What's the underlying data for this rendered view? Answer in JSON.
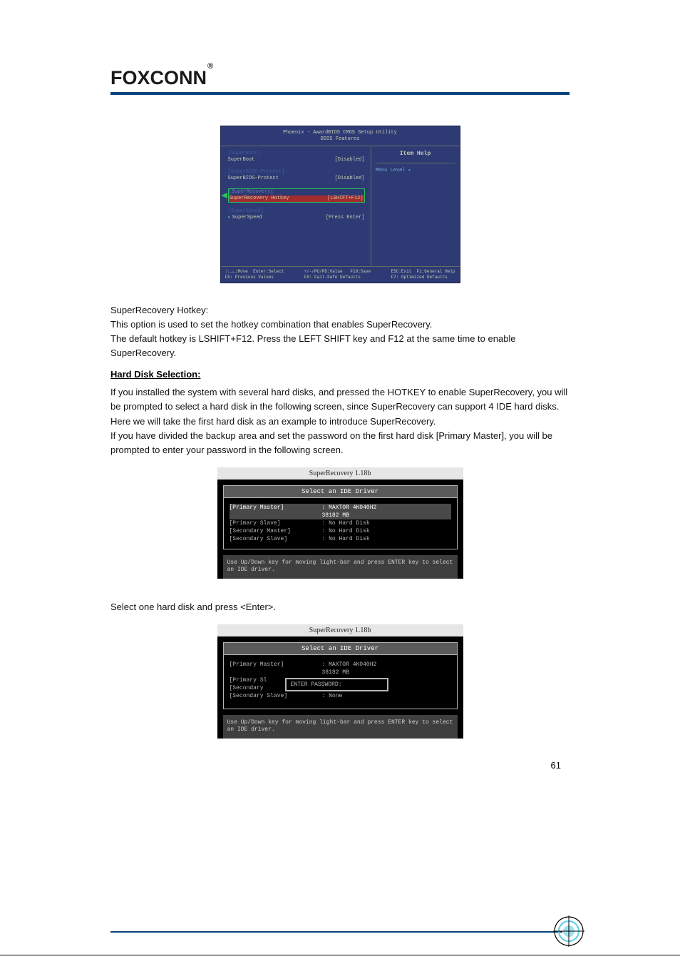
{
  "brand": "FOXCONN",
  "bios": {
    "title1": "Phoenix - AwardBIOS CMOS Setup Utility",
    "title2": "BIOS Features",
    "item_help": "Item Help",
    "menu_level": "Menu Level   ▸",
    "groups": [
      {
        "cat": "[SuperBoot]",
        "label": "SuperBoot",
        "value": "[Disabled]",
        "highlight": false,
        "arrow": false
      },
      {
        "cat": "[SuperBIOS-Protect]",
        "label": "SuperBIOS-Protect",
        "value": "[Disabled]",
        "highlight": false,
        "arrow": false
      },
      {
        "cat": "[SuperRecovery]",
        "label": "SuperRecovery Hotkey",
        "value": "[LSHIFT+F12]",
        "highlight": true,
        "arrow": false
      },
      {
        "cat": "[SuperSpeed]",
        "label": "SuperSpeed",
        "value": "[Press Enter]",
        "highlight": false,
        "arrow": true
      }
    ],
    "footer": {
      "c1": "↑↓→←:Move  Enter:Select\nF5: Previous Values",
      "c2": "+/-/PU/PD:Value   F10:Save\nF6: Fail-Safe Defaults",
      "c3": "ESC:Exit  F1:General Help\nF7: Optimized Defaults"
    }
  },
  "paragraphs": {
    "hotkey_desc": "SuperRecovery Hotkey:\nThis option is used to set the hotkey combination that enables SuperRecovery.\nThe default hotkey is LSHIFT+F12. Press the LEFT SHIFT key and F12 at the same time to enable SuperRecovery.",
    "hd_section_title": "Hard Disk Selection:",
    "hd_section_body": "If you installed the system with several hard disks, and pressed the HOTKEY to enable SuperRecovery, you will be prompted to select a hard disk in the following screen, since SuperRecovery can support 4 IDE hard disks.\nHere we will take the first hard disk as an example to introduce SuperRecovery.\nIf you have divided the backup area and set the password on the first hard disk [Primary Master], you will be prompted to enter your password in the following screen.",
    "sel_label": "Select one hard disk and press <Enter>."
  },
  "sr1": {
    "title": "SuperRecovery 1.18b",
    "box_title": "Select an IDE Driver",
    "rows": [
      {
        "lbl": "[Primary Master]",
        "val": ": MAXTOR 4K040H2",
        "sub": "  38182 MB",
        "sel": true
      },
      {
        "lbl": "[Primary Slave]",
        "val": ": No Hard Disk",
        "sel": false
      },
      {
        "lbl": "[Secondary Master]",
        "val": ": No Hard Disk",
        "sel": false
      },
      {
        "lbl": "[Secondary Slave]",
        "val": ": No Hard Disk",
        "sel": false
      }
    ],
    "hint": "Use Up/Down key for moving light-bar and press ENTER key to select an IDE driver."
  },
  "sr2": {
    "title": "SuperRecovery 1.18b",
    "box_title": "Select an IDE Driver",
    "rows": [
      {
        "lbl": "[Primary Master]",
        "val": ": MAXTOR 4K040H2",
        "sub": "  38182 MB"
      },
      {
        "lbl": "[Primary Sl",
        "val": ""
      },
      {
        "lbl": "[Secondary",
        "val": ""
      },
      {
        "lbl": "[Secondary Slave]",
        "val": ": None"
      }
    ],
    "password_prompt": "ENTER PASSWORD:",
    "hint": "Use Up/Down key for moving light-bar and press ENTER key to select an IDE driver."
  },
  "page_number": "61"
}
